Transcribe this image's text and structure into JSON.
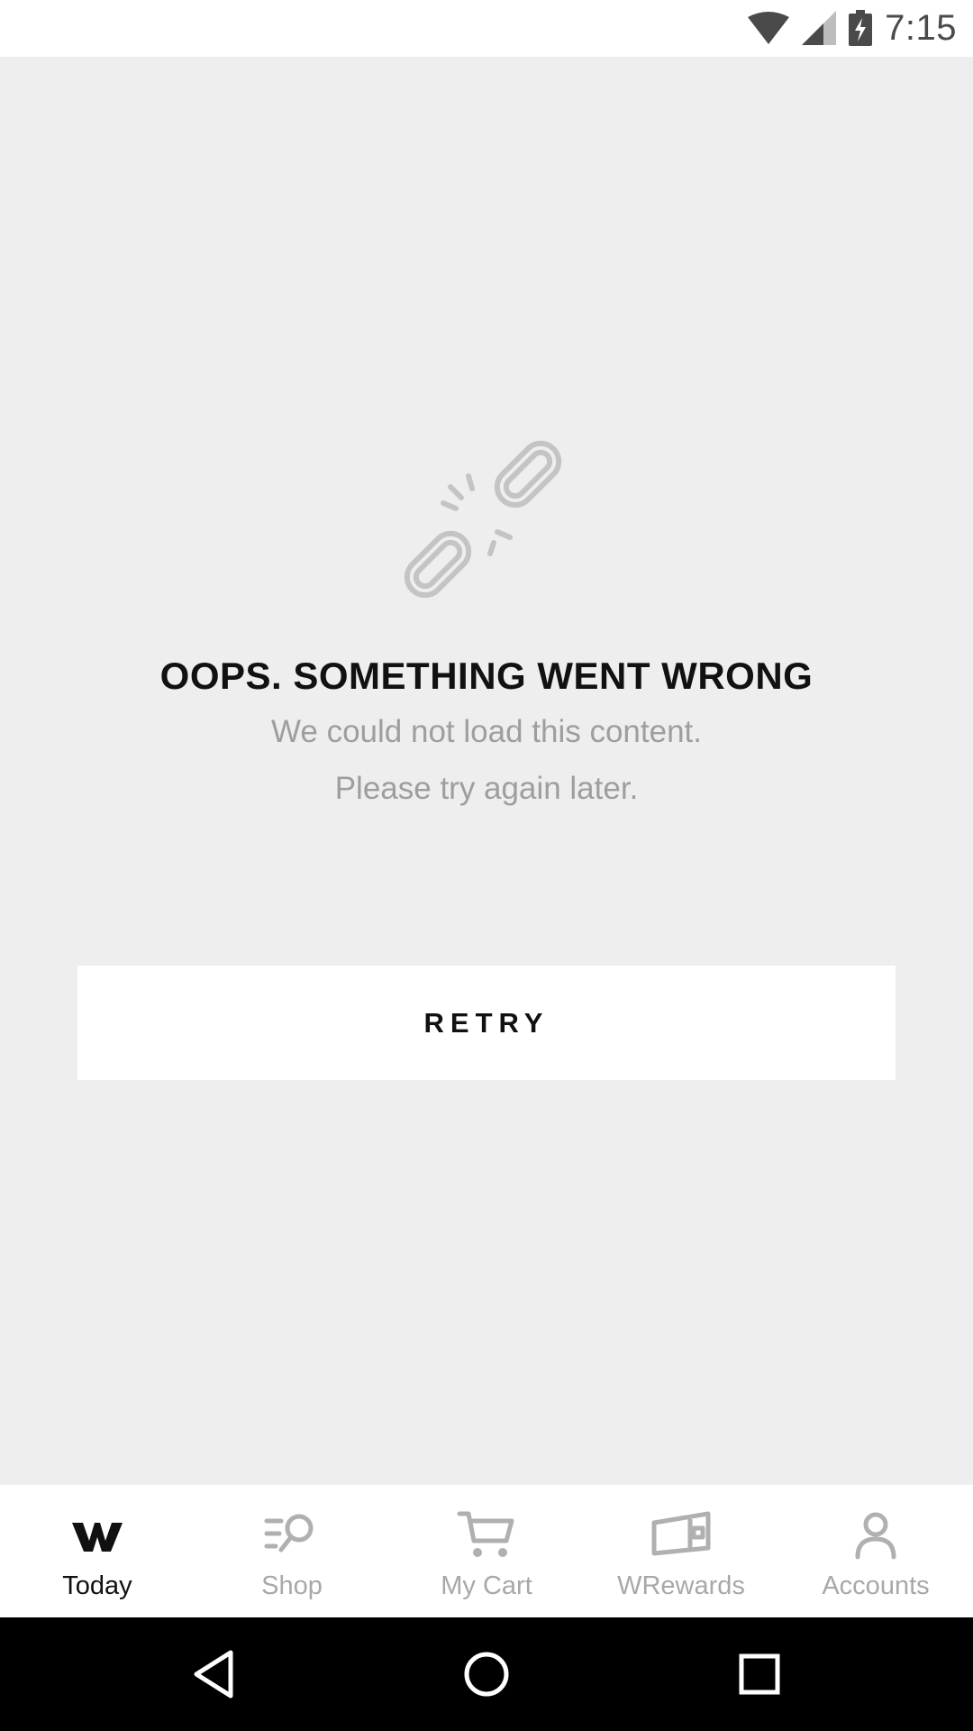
{
  "status_bar": {
    "time": "7:15",
    "icons": [
      "wifi-icon",
      "cell-signal-icon",
      "battery-charging-icon"
    ]
  },
  "error": {
    "icon": "broken-link-icon",
    "title": "OOPS. SOMETHING WENT WRONG",
    "message_line1": "We could not load this content.",
    "message_line2": "Please try again later.",
    "retry_label": "RETRY"
  },
  "bottom_nav": {
    "items": [
      {
        "label": "Today",
        "icon": "w-logo-icon",
        "active": true
      },
      {
        "label": "Shop",
        "icon": "shop-search-icon",
        "active": false
      },
      {
        "label": "My Cart",
        "icon": "cart-icon",
        "active": false
      },
      {
        "label": "WRewards",
        "icon": "rewards-card-icon",
        "active": false
      },
      {
        "label": "Accounts",
        "icon": "account-icon",
        "active": false
      }
    ]
  },
  "colors": {
    "background": "#eeeeee",
    "surface": "#ffffff",
    "primary_text": "#111111",
    "secondary_text": "#9e9e9e",
    "inactive_nav": "#a8a8a8",
    "system_bar": "#000000"
  },
  "system_nav": [
    "back-icon",
    "home-icon",
    "recents-icon"
  ]
}
